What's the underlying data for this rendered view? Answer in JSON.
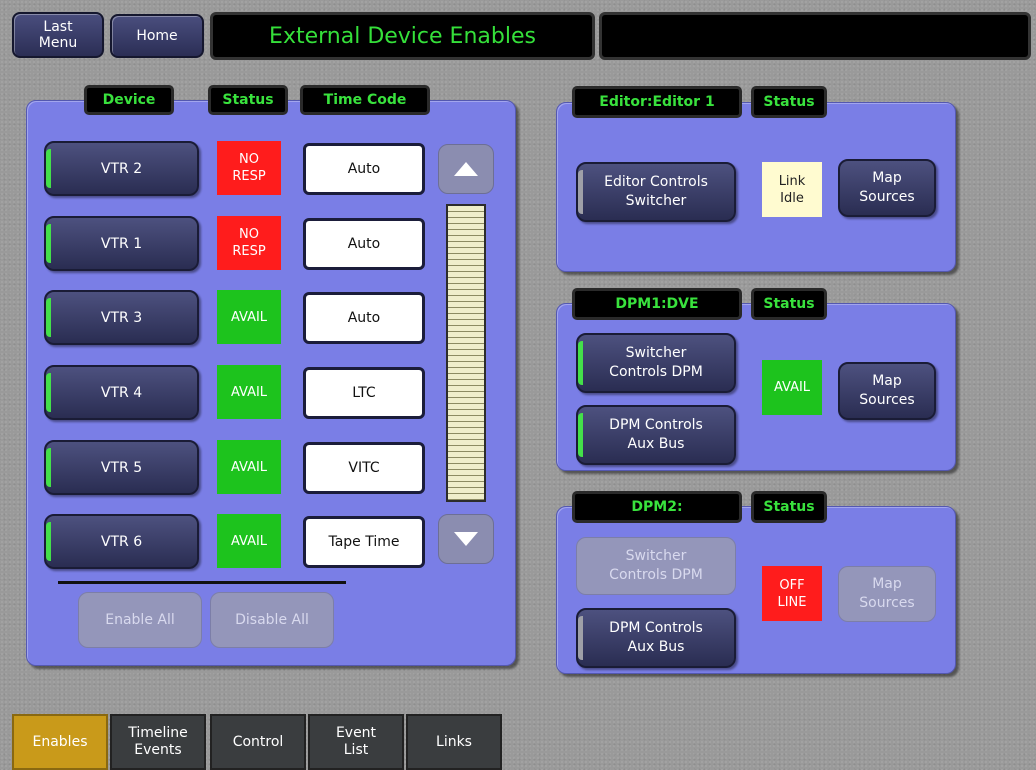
{
  "topbar": {
    "last_menu": "Last\nMenu",
    "home": "Home",
    "title": "External Device Enables",
    "info": ""
  },
  "devices_panel": {
    "headers": {
      "device": "Device",
      "status": "Status",
      "timecode": "Time Code"
    },
    "rows": [
      {
        "device": "VTR 2",
        "status": "NO\nRESP",
        "status_color": "red",
        "timecode": "Auto"
      },
      {
        "device": "VTR 1",
        "status": "NO\nRESP",
        "status_color": "red",
        "timecode": "Auto"
      },
      {
        "device": "VTR 3",
        "status": "AVAIL",
        "status_color": "green",
        "timecode": "Auto"
      },
      {
        "device": "VTR 4",
        "status": "AVAIL",
        "status_color": "green",
        "timecode": "LTC"
      },
      {
        "device": "VTR 5",
        "status": "AVAIL",
        "status_color": "green",
        "timecode": "VITC"
      },
      {
        "device": "VTR 6",
        "status": "AVAIL",
        "status_color": "green",
        "timecode": "Tape Time"
      }
    ],
    "enable_all": "Enable All",
    "disable_all": "Disable All"
  },
  "editor_panel": {
    "header": "Editor:Editor 1",
    "status_header": "Status",
    "control_btn": "Editor Controls\nSwitcher",
    "status": "Link\nIdle",
    "map_sources": "Map\nSources"
  },
  "dpm1_panel": {
    "header": "DPM1:DVE",
    "status_header": "Status",
    "btn1": "Switcher\nControls DPM",
    "btn2": "DPM Controls\nAux Bus",
    "status": "AVAIL",
    "map_sources": "Map\nSources"
  },
  "dpm2_panel": {
    "header": "DPM2:",
    "status_header": "Status",
    "btn1": "Switcher\nControls DPM",
    "btn2": "DPM Controls\nAux Bus",
    "status": "OFF\nLINE",
    "map_sources": "Map\nSources"
  },
  "tabs": [
    {
      "label": "Enables",
      "active": true
    },
    {
      "label": "Timeline\nEvents",
      "active": false
    },
    {
      "label": "Control",
      "active": false
    },
    {
      "label": "Event\nList",
      "active": false
    },
    {
      "label": "Links",
      "active": false
    }
  ],
  "colors": {
    "panel": "#7a7ee6",
    "header_text": "#39e23d",
    "red": "#ff1c1c",
    "green": "#1dc31d",
    "active_tab": "#c99a1a"
  }
}
